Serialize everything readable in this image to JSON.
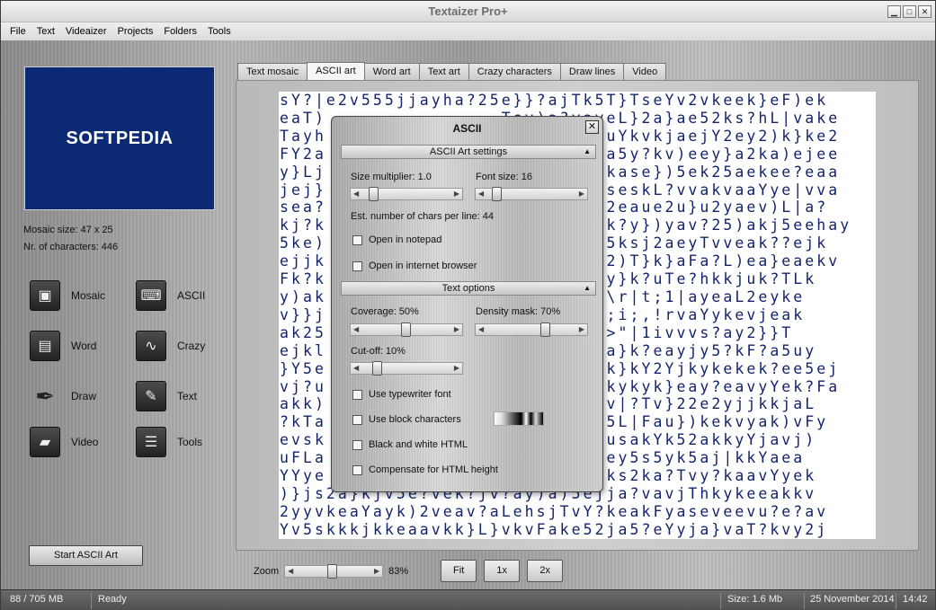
{
  "window": {
    "title": "Textaizer Pro+"
  },
  "menu": [
    "File",
    "Text",
    "Videaizer",
    "Projects",
    "Folders",
    "Tools"
  ],
  "logo_text": "SOFTPEDIA",
  "info": {
    "mosaic_size": "Mosaic size: 47 x 25",
    "nr_chars": "Nr. of characters: 446"
  },
  "tools": [
    {
      "label": "Mosaic",
      "icon": "mosaic-icon",
      "glyph": "▣"
    },
    {
      "label": "ASCII",
      "icon": "keyboard-icon",
      "glyph": "⌨"
    },
    {
      "label": "Word",
      "icon": "book-icon",
      "glyph": "📖"
    },
    {
      "label": "Crazy",
      "icon": "waveform-icon",
      "glyph": "∿"
    },
    {
      "label": "Draw",
      "icon": "feather-icon",
      "glyph": "✒"
    },
    {
      "label": "Text",
      "icon": "pencil-icon",
      "glyph": "✎"
    },
    {
      "label": "Video",
      "icon": "clapperboard-icon",
      "glyph": "🎬"
    },
    {
      "label": "Tools",
      "icon": "sliders-icon",
      "glyph": "☰"
    }
  ],
  "start_button": "Start ASCII Art",
  "tabs": [
    "Text mosaic",
    "ASCII art",
    "Word art",
    "Text art",
    "Crazy characters",
    "Draw lines",
    "Video"
  ],
  "active_tab": 1,
  "ascii_lines": [
    "sY?|e2v555jjayha?25e}}?ajTk5T}TseYv2vkeek}eF)ek",
    "eaT)               Tsv)a?vaveL}2a}ae52ks?hL|vake",
    "Tayh               55kaeYvkauYkvkjaejY2ey2)k}ke2",
    "FY2a               ?Yaa5vYkaa5y?kv)eey}a2ka)ejee",
    "y}Lj               }jaeakY|5kase})5ek25aekee?eaa",
    "jej}               v|5}e?ajjseskL?vvakvaaYye|vva",
    "sea?               y|kYee|kk2eaue2u}u2yaev)L|a?",
    "kj?k               ?yj?vjy)ak?y})yav?25)akj5eehay",
    "5ke)               2ke|yeY2j5ksj2aeyTvveak??ejk",
    "ejjk               yeajjakYk2)T}k}aFa?L)ea}eaekv",
    "Fk?k               a)ej?aaYFy}k?uTe?hkkjuk?TLk",
    "y)ak               jjsksh|^;\\r|t;1|ayeaL2eyke",
    "v}}j               kk|;vk;|r;i;,!rvaYykevjeak",
    "ak25               2Y)k!!\\\"j>\"|1ivvvs?ay2}}T",
    "ejkl               j|a}}ka2ha}k?eayjy5?kF?a5uy",
    "}Y5e               ?aYav|v)vk}kY2Yjkykekek?ee5ej",
    "vj?u               a?ak?2vvvkykyk}eay?eavyYek?Fa",
    "akk)               2j|)?eLjsv|?Tv}22e2yjjkkjaL",
    "?kTa               e|a)e2ke?5L|Fau})kekvyak)vFy",
    "evsk               j2ej?Tk2jusakYk52akkyYjavj)",
    "uFLa               a2k?jj2k?ey5s5yk5aj|kkYaea",
    "YYye               2|YYY?}?yks2ka?Tvy?kaavYyek",
    ")}js2a}kjv5e?vek?jv?ay)a)5ejja?vavjThkykeeakkv",
    "2yyvkeaYayk)2veav?aLehsjTvY?keakFyaseveevu?e?av",
    "Yv5skkkjkkeaavkk}L}vkvFake52ja5?eYyja}vaT?kvy2j"
  ],
  "zoom": {
    "label": "Zoom",
    "value": "83%",
    "level": 83
  },
  "zoom_buttons": [
    "Fit",
    "1x",
    "2x"
  ],
  "status": {
    "memory": "88 / 705 MB",
    "state": "Ready",
    "size": "Size: 1.6 Mb",
    "date": "25 November 2014",
    "time": "14:42"
  },
  "dialog": {
    "title": "ASCII",
    "section1": "ASCII Art settings",
    "size_multiplier": "Size multiplier: 1.0",
    "font_size": "Font size: 16",
    "est_chars": "Est. number of chars per line: 44",
    "open_notepad": "Open in notepad",
    "open_browser": "Open in internet browser",
    "section2": "Text options",
    "coverage": "Coverage: 50%",
    "density": "Density mask: 70%",
    "cutoff": "Cut-off: 10%",
    "typewriter": "Use typewriter font",
    "block_chars": "Use block characters",
    "bw_html": "Black and white HTML",
    "compensate": "Compensate for HTML height"
  }
}
